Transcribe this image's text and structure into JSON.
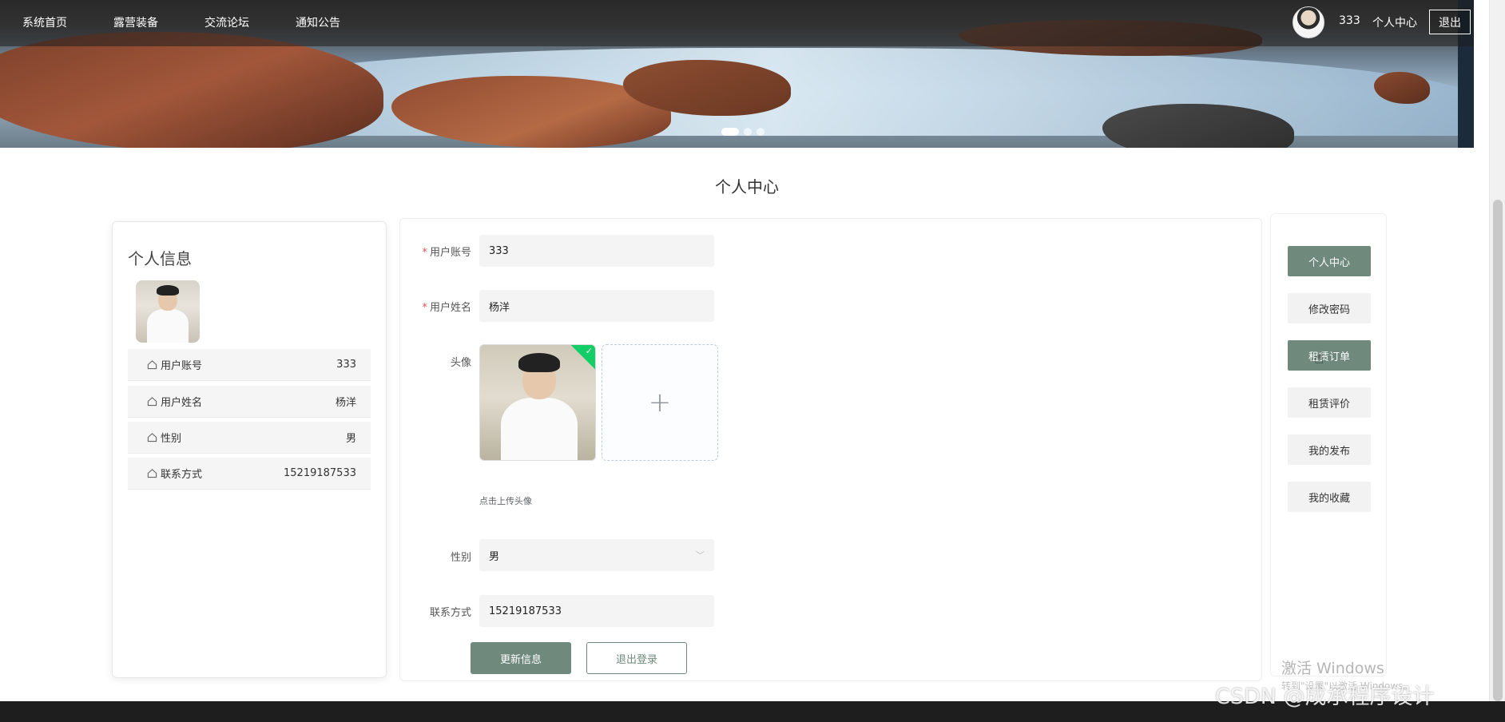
{
  "nav": {
    "links": [
      "系统首页",
      "露营装备",
      "交流论坛",
      "通知公告"
    ],
    "username": "333",
    "personal_center": "个人中心",
    "logout": "退出"
  },
  "carousel": {
    "slides": 3,
    "active": 1
  },
  "page_title": "个人中心",
  "profile": {
    "title": "个人信息",
    "rows": [
      {
        "label": "用户账号",
        "value": "333"
      },
      {
        "label": "用户姓名",
        "value": "杨洋"
      },
      {
        "label": "性别",
        "value": "男"
      },
      {
        "label": "联系方式",
        "value": "15219187533"
      }
    ]
  },
  "form": {
    "account_label": "用户账号",
    "account_value": "333",
    "name_label": "用户姓名",
    "name_value": "杨洋",
    "avatar_label": "头像",
    "upload_tip": "点击上传头像",
    "gender_label": "性别",
    "gender_value": "男",
    "phone_label": "联系方式",
    "phone_value": "15219187533",
    "update_button": "更新信息",
    "logout_button": "退出登录"
  },
  "side_menu": [
    "个人中心",
    "修改密码",
    "租赁订单",
    "租赁评价",
    "我的发布",
    "我的收藏"
  ],
  "overlay": {
    "windows_activate": "激活 Windows",
    "windows_sub": "转到\"设置\"以激活 Windows。",
    "watermark": "CSDN @成承程序设计"
  },
  "colors": {
    "accent": "#6f8a7d",
    "required": "#e25555",
    "success": "#13ce66"
  }
}
